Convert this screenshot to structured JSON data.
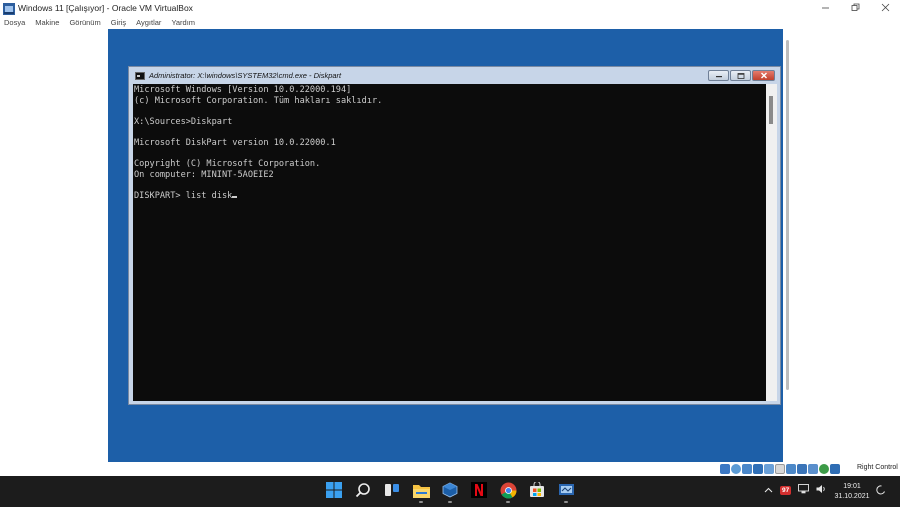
{
  "host_window": {
    "title": "Windows 11 [Çalışıyor] - Oracle VM VirtualBox",
    "controls": {
      "minimize_icon": "minimize-icon",
      "maximize_icon": "restore-icon",
      "close_icon": "close-icon"
    }
  },
  "menu": {
    "items": [
      "Dosya",
      "Makine",
      "Görünüm",
      "Giriş",
      "Aygıtlar",
      "Yardım"
    ]
  },
  "cmd_window": {
    "title": "Administrator: X:\\windows\\SYSTEM32\\cmd.exe - Diskpart",
    "lines": [
      "Microsoft Windows [Version 10.0.22000.194]",
      "(c) Microsoft Corporation. Tüm hakları saklıdır.",
      "",
      "X:\\Sources>Diskpart",
      "",
      "Microsoft DiskPart version 10.0.22000.1",
      "",
      "Copyright (C) Microsoft Corporation.",
      "On computer: MININT-5AOEIE2",
      ""
    ],
    "prompt": "DISKPART> ",
    "input_value": "list disk"
  },
  "statusbar": {
    "icons": [
      "hard-disk-icon",
      "optical-drive-icon",
      "audio-icon",
      "network-icon",
      "usb-icon",
      "shared-folder-icon",
      "display-icon",
      "recording-icon",
      "cpu-icon",
      "mouse-integration-icon",
      "keyboard-icon"
    ],
    "host_key": "Right Control"
  },
  "taskbar": {
    "apps": [
      "windows-start-icon",
      "search-icon",
      "task-view-icon",
      "file-explorer-icon",
      "virtualbox-icon",
      "netflix-icon",
      "chrome-icon",
      "microsoft-store-icon",
      "virtualbox-manager-icon"
    ],
    "tray_badge": "97",
    "time": "19:01",
    "date": "31.10.2021"
  },
  "colors": {
    "guest_desktop": "#1d5fa8",
    "console_bg": "#0c0c0c",
    "console_text": "#cccccc",
    "taskbar_bg": "#1c1c1c"
  }
}
